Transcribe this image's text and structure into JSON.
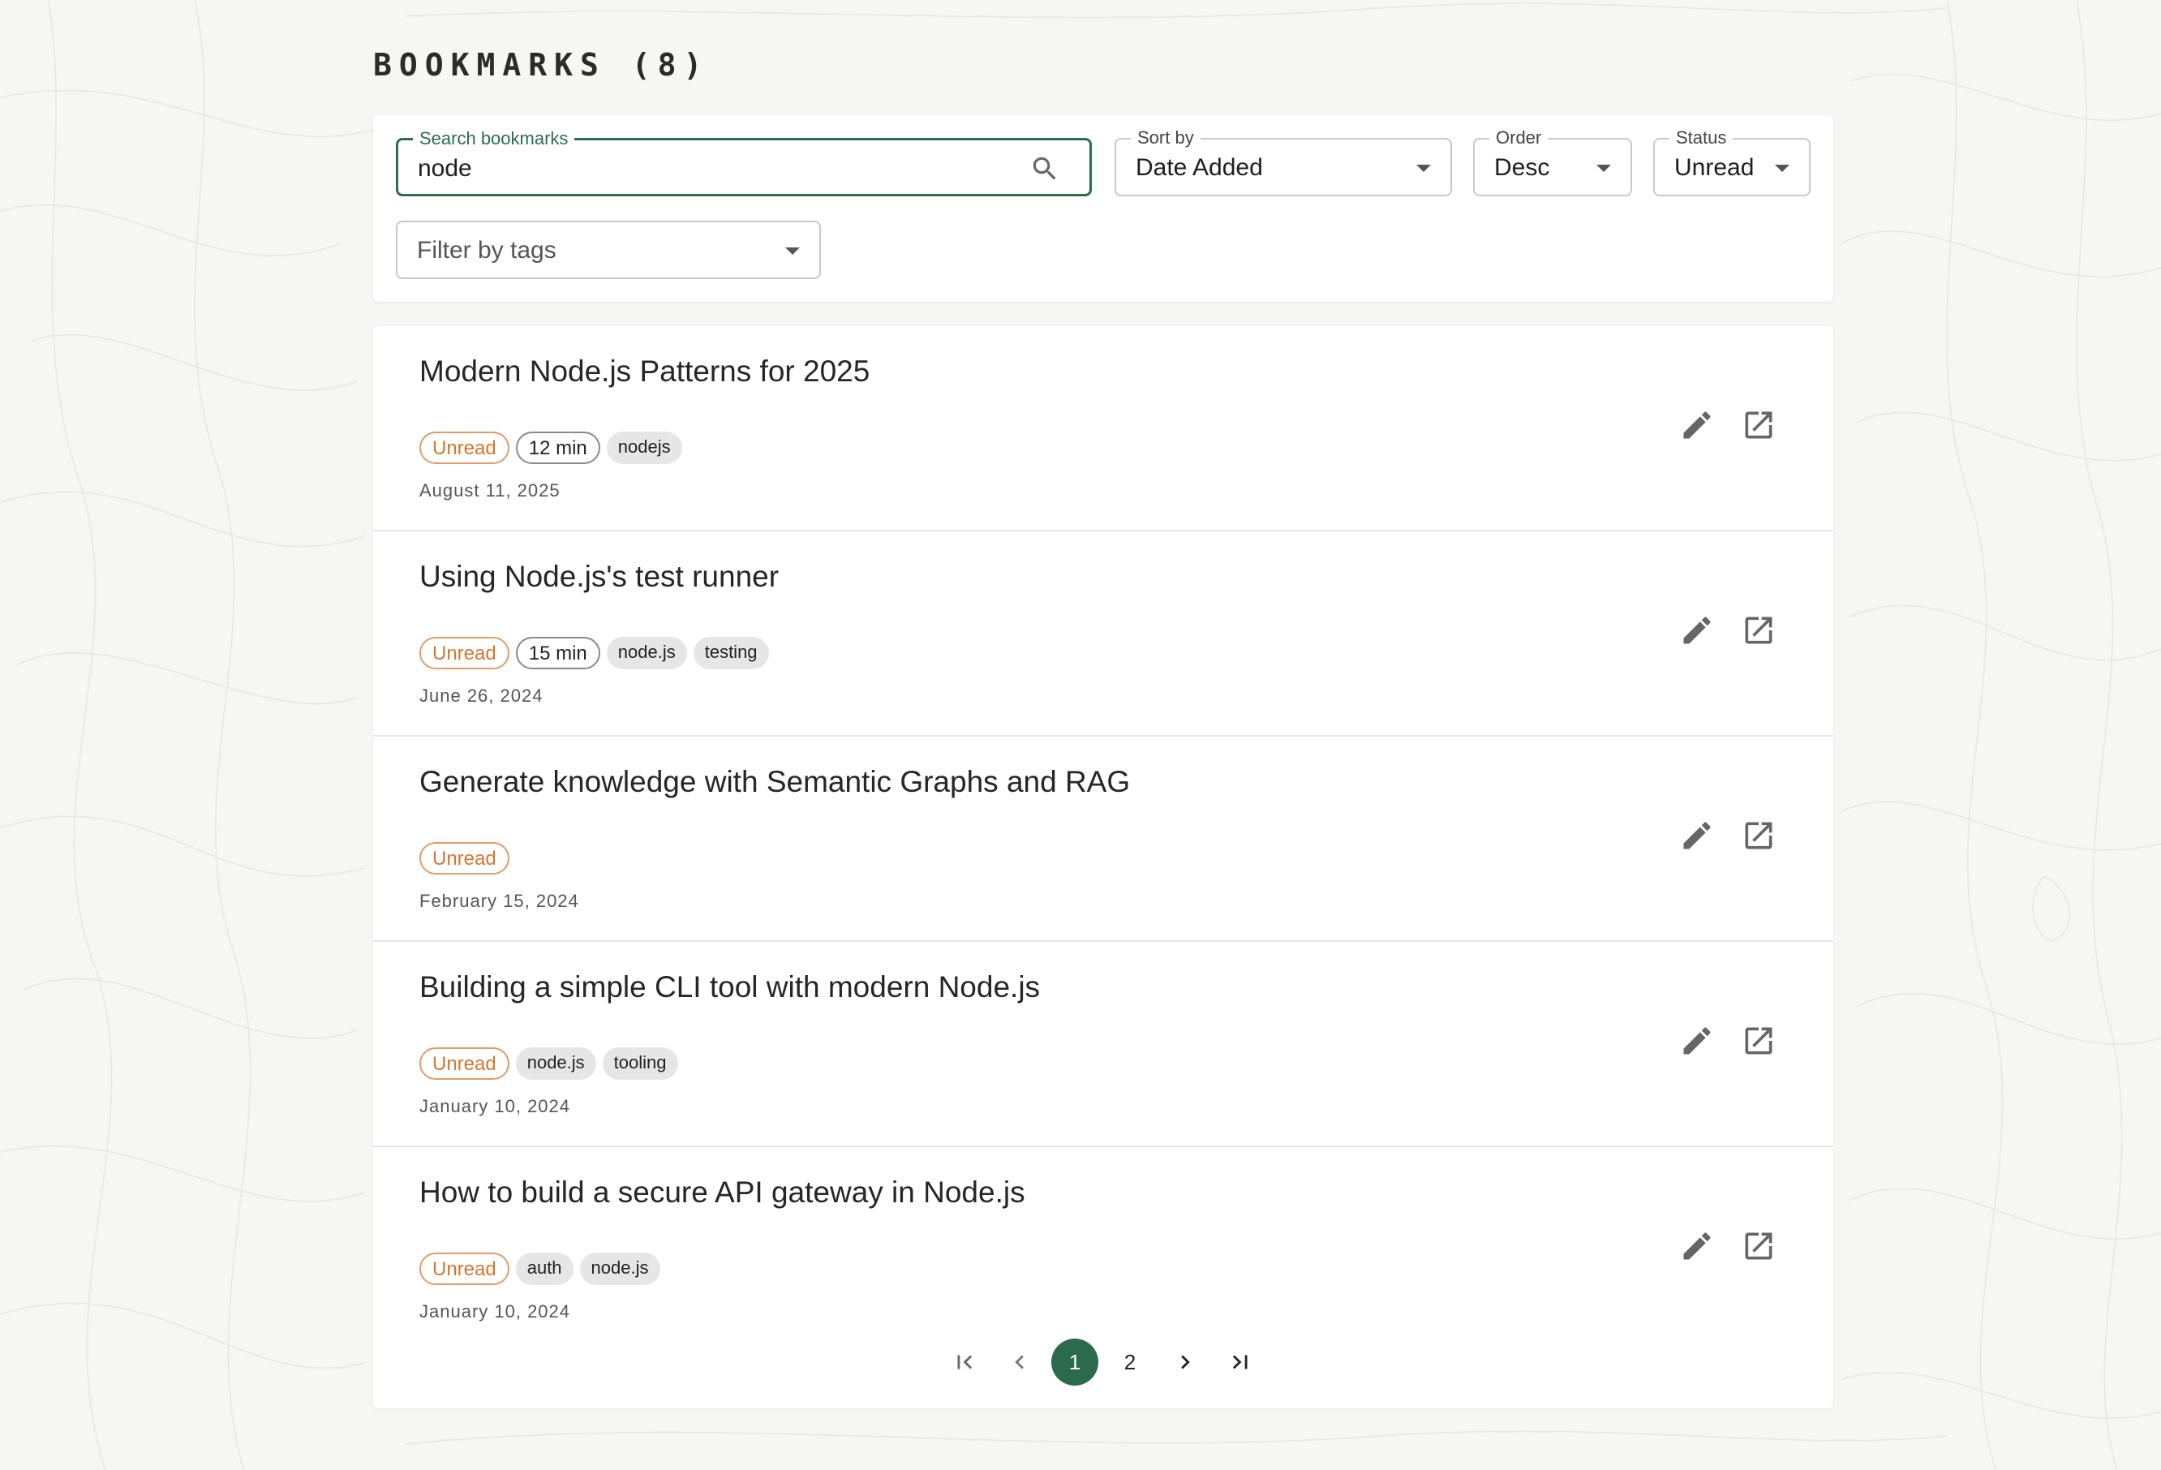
{
  "page": {
    "title": "BOOKMARKS (8)"
  },
  "filters": {
    "search": {
      "label": "Search bookmarks",
      "value": "node"
    },
    "sort_by": {
      "label": "Sort by",
      "value": "Date Added"
    },
    "order": {
      "label": "Order",
      "value": "Desc"
    },
    "status": {
      "label": "Status",
      "value": "Unread"
    },
    "tags": {
      "placeholder": "Filter by tags"
    }
  },
  "bookmarks": [
    {
      "title": "Modern Node.js Patterns for 2025",
      "status": "Unread",
      "read_time": "12 min",
      "tags": [
        "nodejs"
      ],
      "date": "August 11, 2025"
    },
    {
      "title": "Using Node.js's test runner",
      "status": "Unread",
      "read_time": "15 min",
      "tags": [
        "node.js",
        "testing"
      ],
      "date": "June 26, 2024"
    },
    {
      "title": "Generate knowledge with Semantic Graphs and RAG",
      "status": "Unread",
      "read_time": "",
      "tags": [],
      "date": "February 15, 2024"
    },
    {
      "title": "Building a simple CLI tool with modern Node.js",
      "status": "Unread",
      "read_time": "",
      "tags": [
        "node.js",
        "tooling"
      ],
      "date": "January 10, 2024"
    },
    {
      "title": "How to build a secure API gateway in Node.js",
      "status": "Unread",
      "read_time": "",
      "tags": [
        "auth",
        "node.js"
      ],
      "date": "January 10, 2024"
    }
  ],
  "pagination": {
    "pages": [
      "1",
      "2"
    ],
    "current": "1"
  },
  "icons": {
    "edit": "pencil-icon",
    "open": "open-in-new-icon",
    "search": "search-icon",
    "first": "first-page-icon",
    "prev": "chevron-left-icon",
    "next": "chevron-right-icon",
    "last": "last-page-icon"
  },
  "colors": {
    "accent": "#2b6b4c",
    "status_unread": "#d4762f",
    "background": "#f6f7f2"
  }
}
